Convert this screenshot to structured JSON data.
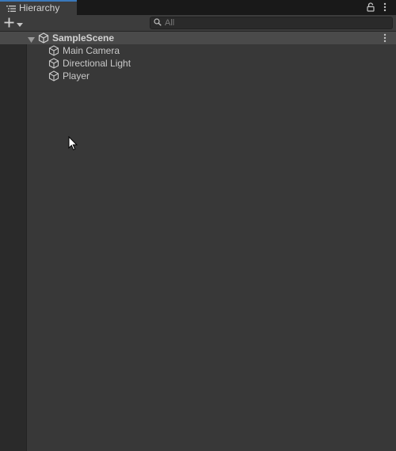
{
  "tab": {
    "title": "Hierarchy"
  },
  "toolbar": {
    "search_placeholder": "All"
  },
  "scene": {
    "name": "SampleScene",
    "expanded": true
  },
  "objects": [
    {
      "label": "Main Camera",
      "icon": "cube-icon"
    },
    {
      "label": "Directional Light",
      "icon": "cube-icon"
    },
    {
      "label": "Player",
      "icon": "cube-icon"
    }
  ],
  "colors": {
    "accent": "#3a79bb",
    "panel": "#383838",
    "scene_row": "#4a4a4a"
  }
}
